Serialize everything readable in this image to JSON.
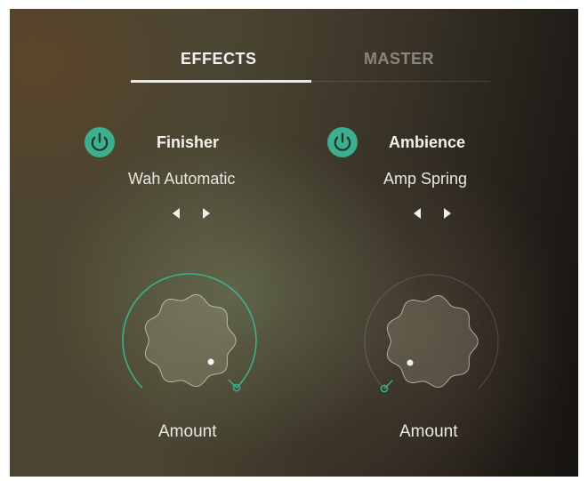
{
  "tabs": {
    "effects_label": "EFFECTS",
    "master_label": "MASTER",
    "active": "effects"
  },
  "slots": [
    {
      "name": "Finisher",
      "preset": "Wah Automatic",
      "enabled": true,
      "knob_label": "Amount",
      "knob_value": 1.0
    },
    {
      "name": "Ambience",
      "preset": "Amp Spring",
      "enabled": true,
      "knob_label": "Amount",
      "knob_value": 0.0
    }
  ],
  "colors": {
    "accent": "#3dae8e",
    "text": "#f2f2f0",
    "inactive_tab": "#8c8680"
  },
  "icons": {
    "power": "power-icon",
    "prev": "triangle-left-icon",
    "next": "triangle-right-icon"
  }
}
